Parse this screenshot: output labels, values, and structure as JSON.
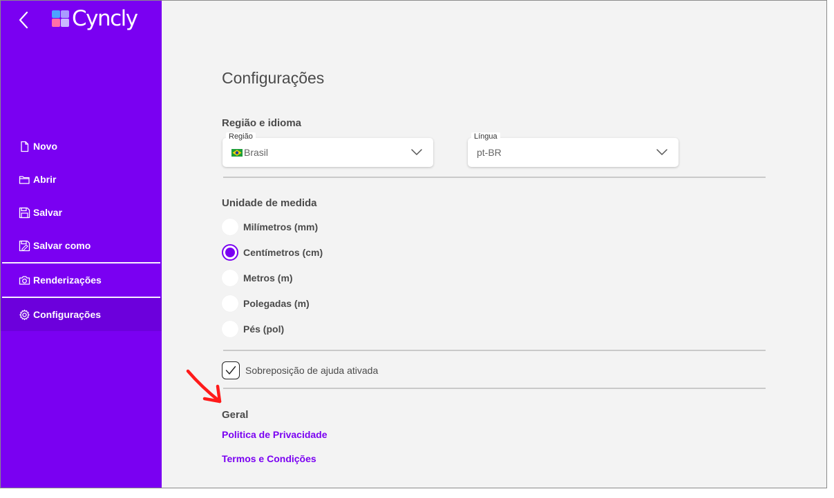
{
  "app": {
    "logo_text": "Cyncly"
  },
  "sidebar": {
    "items": [
      {
        "label": "Novo",
        "icon": "file-icon"
      },
      {
        "label": "Abrir",
        "icon": "folder-icon"
      },
      {
        "label": "Salvar",
        "icon": "save-icon"
      },
      {
        "label": "Salvar como",
        "icon": "save-as-icon"
      },
      {
        "label": "Renderizações",
        "icon": "camera-icon"
      },
      {
        "label": "Configurações",
        "icon": "gear-icon",
        "active": true
      }
    ]
  },
  "page": {
    "title": "Configurações"
  },
  "region_language": {
    "title": "Região e idioma",
    "region": {
      "label": "Região",
      "value": "Brasil"
    },
    "language": {
      "label": "Língua",
      "value": "pt-BR"
    }
  },
  "units": {
    "title": "Unidade de medida",
    "options": [
      {
        "label": "Milímetros (mm)",
        "checked": false
      },
      {
        "label": "Centímetros (cm)",
        "checked": true
      },
      {
        "label": "Metros (m)",
        "checked": false
      },
      {
        "label": "Polegadas (m)",
        "checked": false
      },
      {
        "label": "Pés (pol)",
        "checked": false
      }
    ]
  },
  "help_overlay": {
    "label": "Sobreposição de ajuda ativada",
    "checked": true
  },
  "general": {
    "title": "Geral",
    "privacy_link": "Politica de Privacidade",
    "terms_link": "Termos e Condições"
  },
  "colors": {
    "brand": "#7a00f2",
    "annotation_arrow": "#ff1a1a"
  }
}
